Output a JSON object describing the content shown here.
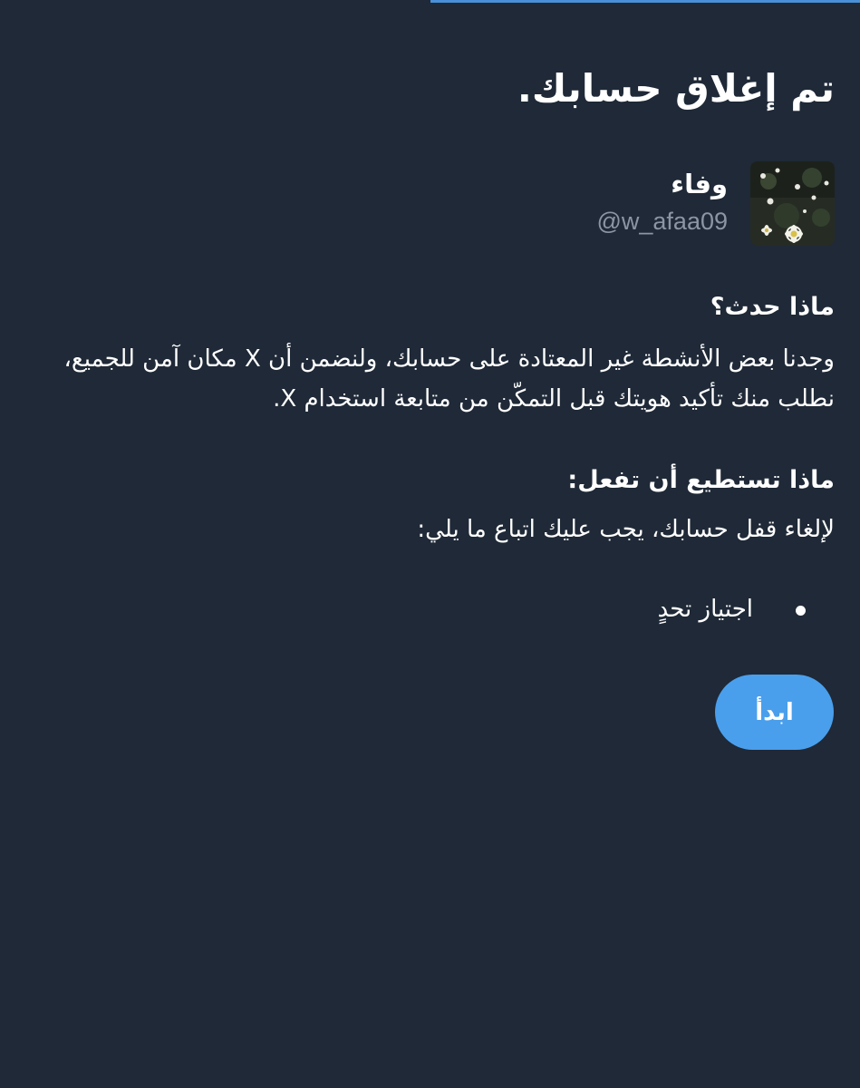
{
  "progress": {
    "fraction": 0.5
  },
  "header": {
    "title": "تم إغلاق حسابك."
  },
  "account": {
    "display_name": "وفاء",
    "handle": "@w_afaa09",
    "avatar_icon": "daisy-flowers-photo"
  },
  "what_happened": {
    "heading": "ماذا حدث؟",
    "text": "وجدنا بعض الأنشطة غير المعتادة على حسابك، ولنضمن أن X مكان آمن للجميع، نطلب منك تأكيد هويتك قبل التمكّن من متابعة استخدام X."
  },
  "what_you_can_do": {
    "heading": "ماذا تستطيع أن تفعل:",
    "text": "لإلغاء قفل حسابك، يجب عليك اتباع ما يلي:",
    "steps": [
      "اجتياز تحدٍ"
    ]
  },
  "actions": {
    "start_label": "ابدأ"
  },
  "colors": {
    "background": "#1f2937",
    "accent": "#4a9fec",
    "progress": "#4a90d9",
    "secondary_text": "#8b95a3"
  }
}
